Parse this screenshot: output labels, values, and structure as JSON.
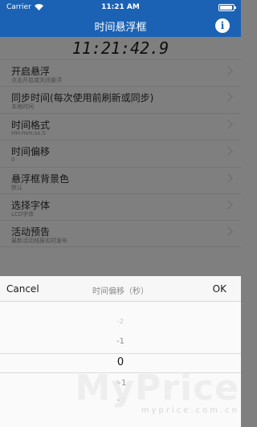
{
  "status_bar": {
    "carrier": "Carrier",
    "time": "11:21 AM"
  },
  "nav": {
    "title": "时间悬浮框",
    "info_glyph": "i"
  },
  "clock": "11:21:42.9",
  "settings": [
    {
      "title": "开启悬浮",
      "subtitle": "点击开启或关闭悬浮"
    },
    {
      "title": "同步时间(每次使用前刷新或同步)",
      "subtitle": "本地时间"
    },
    {
      "title": "时间格式",
      "subtitle": "HH:mm:ss.S"
    },
    {
      "title": "时间偏移",
      "subtitle": "0"
    },
    {
      "title": "悬浮框背景色",
      "subtitle": "默认"
    },
    {
      "title": "选择字体",
      "subtitle": "LCD字体"
    },
    {
      "title": "活动预告",
      "subtitle": "最新活动线报实时发布"
    }
  ],
  "picker": {
    "cancel_label": "Cancel",
    "title": "时间偏移（秒）",
    "ok_label": "OK",
    "values": [
      "-2",
      "-1",
      "0",
      "+1",
      "+2"
    ],
    "selected_value": "0"
  },
  "watermark": {
    "brand": "MyPrice",
    "url": "myprice.com.cn"
  },
  "colors": {
    "nav_blue": "#1b62b5",
    "overlay_gray": "#7f7f7f"
  }
}
